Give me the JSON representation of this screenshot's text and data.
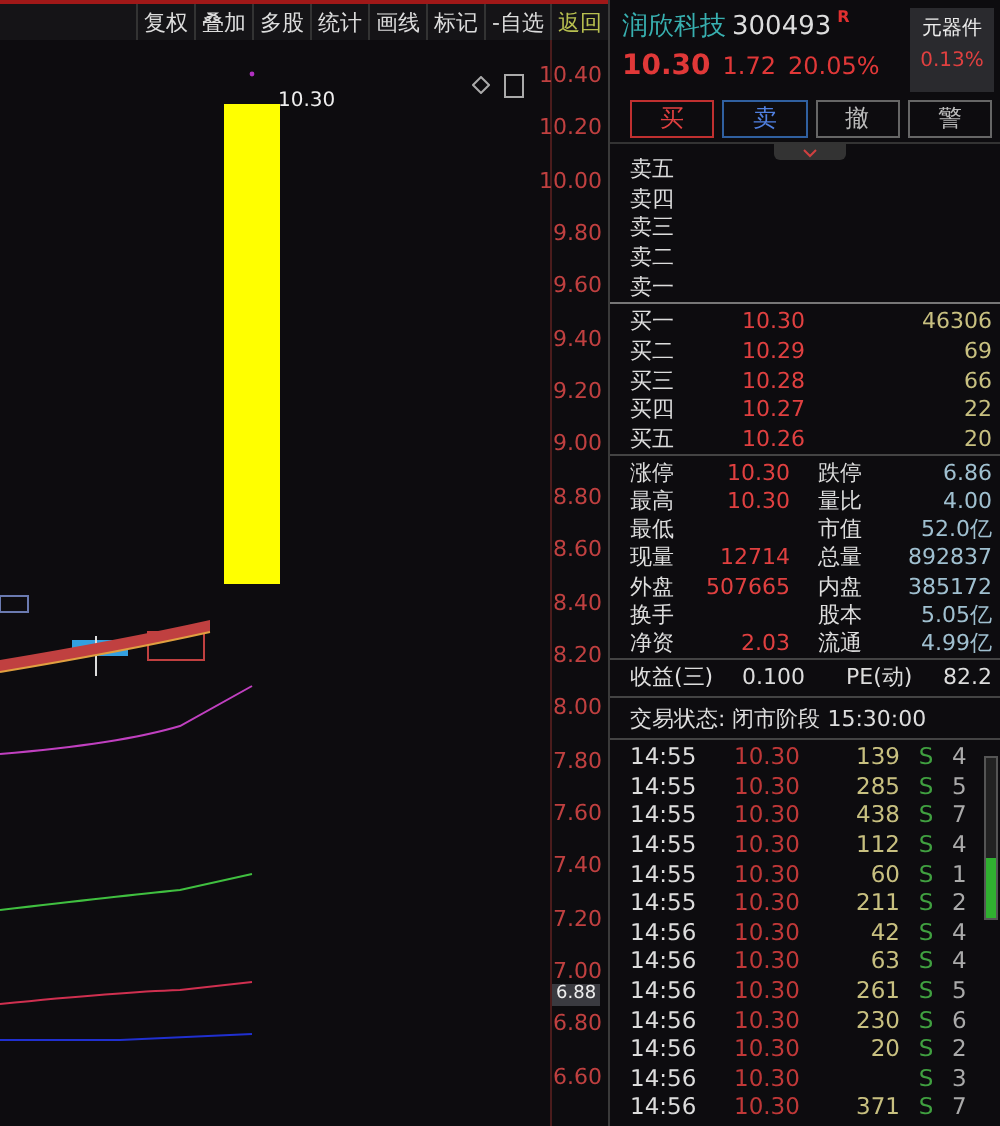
{
  "toolbar": [
    {
      "label": "复权",
      "kind": "tool"
    },
    {
      "label": "叠加",
      "kind": "tool"
    },
    {
      "label": "多股",
      "kind": "tool"
    },
    {
      "label": "统计",
      "kind": "tool"
    },
    {
      "label": "画线",
      "kind": "tool"
    },
    {
      "label": "标记",
      "kind": "tool"
    },
    {
      "label": "-自选",
      "kind": "tool"
    },
    {
      "label": "返回",
      "kind": "back"
    }
  ],
  "chart": {
    "high_label": "10.30",
    "price_tag": "6.88",
    "axis": [
      "10.40",
      "10.20",
      "10.00",
      "9.80",
      "9.60",
      "9.40",
      "9.20",
      "9.00",
      "8.80",
      "8.60",
      "8.40",
      "8.20",
      "8.00",
      "7.80",
      "7.60",
      "7.40",
      "7.20",
      "7.00",
      "6.80",
      "6.60"
    ]
  },
  "quote": {
    "name": "润欣科技",
    "code": "300493",
    "badge": "R",
    "price": "10.30",
    "change": "1.72",
    "percent": "20.05%",
    "sector": "元器件",
    "sector_percent": "0.13%"
  },
  "actions": [
    {
      "label": "买",
      "kind": "buy"
    },
    {
      "label": "卖",
      "kind": "sell"
    },
    {
      "label": "撤",
      "kind": "plain"
    },
    {
      "label": "警",
      "kind": "plain"
    }
  ],
  "asks": [
    {
      "label": "卖五"
    },
    {
      "label": "卖四"
    },
    {
      "label": "卖三"
    },
    {
      "label": "卖二"
    },
    {
      "label": "卖一"
    }
  ],
  "bids": [
    {
      "label": "买一",
      "price": "10.30",
      "volume": "46306"
    },
    {
      "label": "买二",
      "price": "10.29",
      "volume": "69"
    },
    {
      "label": "买三",
      "price": "10.28",
      "volume": "66"
    },
    {
      "label": "买四",
      "price": "10.27",
      "volume": "22"
    },
    {
      "label": "买五",
      "price": "10.26",
      "volume": "20"
    }
  ],
  "stats": [
    {
      "label": "涨停",
      "value": "10.30",
      "label_2": "跌停",
      "value_2": "6.86"
    },
    {
      "label": "最高",
      "value": "10.30",
      "label_2": "量比",
      "value_2": "4.00"
    },
    {
      "label": "最低",
      "label_2": "市值",
      "value_2": "52.0亿"
    },
    {
      "label": "现量",
      "value": "12714",
      "label_2": "总量",
      "value_2": "892837"
    },
    {
      "label": "外盘",
      "value": "507665",
      "label_2": "内盘",
      "value_2": "385172"
    },
    {
      "label": "换手",
      "label_2": "股本",
      "value_2": "5.05亿"
    },
    {
      "label": "净资",
      "value": "2.03",
      "label_2": "流通",
      "value_2": "4.99亿"
    }
  ],
  "earnings": {
    "label": "收益(三)",
    "value": "0.100",
    "label_2": "PE(动)",
    "value_2": "82.2"
  },
  "status": "交易状态: 闭市阶段 15:30:00",
  "trades": [
    {
      "time": "14:55",
      "price": "10.30",
      "volume": "139",
      "side": "S",
      "column_5": "4"
    },
    {
      "time": "14:55",
      "price": "10.30",
      "volume": "285",
      "side": "S",
      "column_5": "5"
    },
    {
      "time": "14:55",
      "price": "10.30",
      "volume": "438",
      "side": "S",
      "column_5": "7"
    },
    {
      "time": "14:55",
      "price": "10.30",
      "volume": "112",
      "side": "S",
      "column_5": "4"
    },
    {
      "time": "14:55",
      "price": "10.30",
      "volume": "60",
      "side": "S",
      "column_5": "1"
    },
    {
      "time": "14:55",
      "price": "10.30",
      "volume": "211",
      "side": "S",
      "column_5": "2"
    },
    {
      "time": "14:56",
      "price": "10.30",
      "volume": "42",
      "side": "S",
      "column_5": "4"
    },
    {
      "time": "14:56",
      "price": "10.30",
      "volume": "63",
      "side": "S",
      "column_5": "4"
    },
    {
      "time": "14:56",
      "price": "10.30",
      "volume": "261",
      "side": "S",
      "column_5": "5"
    },
    {
      "time": "14:56",
      "price": "10.30",
      "volume": "230",
      "side": "S",
      "column_5": "6"
    },
    {
      "time": "14:56",
      "price": "10.30",
      "volume": "20",
      "side": "S",
      "column_5": "2"
    },
    {
      "time": "14:56",
      "price": "10.30",
      "side": "S",
      "column_5": "3"
    },
    {
      "time": "14:56",
      "price": "10.30",
      "volume": "371",
      "side": "S",
      "column_5": "7"
    }
  ]
}
